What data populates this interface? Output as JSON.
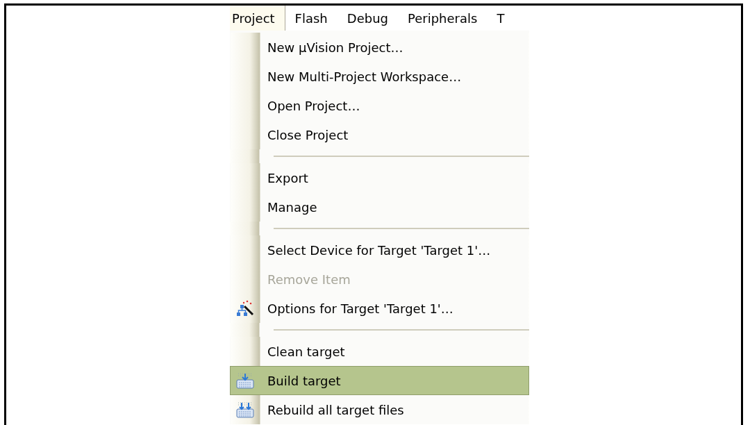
{
  "menu_bar": [
    {
      "label": "Project",
      "selected": true
    },
    {
      "label": "Flash",
      "selected": false
    },
    {
      "label": "Debug",
      "selected": false
    },
    {
      "label": "Peripherals",
      "selected": false
    },
    {
      "label": "T",
      "selected": false
    }
  ],
  "menu": {
    "items": [
      {
        "kind": "item",
        "label": "New µVision Project…",
        "disabled": false,
        "selected": false
      },
      {
        "kind": "item",
        "label": "New Multi-Project Workspace…",
        "disabled": false,
        "selected": false
      },
      {
        "kind": "item",
        "label": "Open Project…",
        "disabled": false,
        "selected": false
      },
      {
        "kind": "item",
        "label": "Close Project",
        "disabled": false,
        "selected": false
      },
      {
        "kind": "separator"
      },
      {
        "kind": "item",
        "label": "Export",
        "disabled": false,
        "selected": false
      },
      {
        "kind": "item",
        "label": "Manage",
        "disabled": false,
        "selected": false
      },
      {
        "kind": "separator"
      },
      {
        "kind": "item",
        "label": "Select Device for Target 'Target 1'…",
        "disabled": false,
        "selected": false
      },
      {
        "kind": "item",
        "label": "Remove Item",
        "disabled": true,
        "selected": false
      },
      {
        "kind": "options",
        "label": "Options for Target 'Target 1'…",
        "disabled": false,
        "selected": false
      },
      {
        "kind": "separator"
      },
      {
        "kind": "item",
        "label": "Clean target",
        "disabled": false,
        "selected": false
      },
      {
        "kind": "build",
        "label": "Build target",
        "disabled": false,
        "selected": true
      },
      {
        "kind": "rebuild",
        "label": "Rebuild all target files",
        "disabled": false,
        "selected": false
      }
    ]
  }
}
